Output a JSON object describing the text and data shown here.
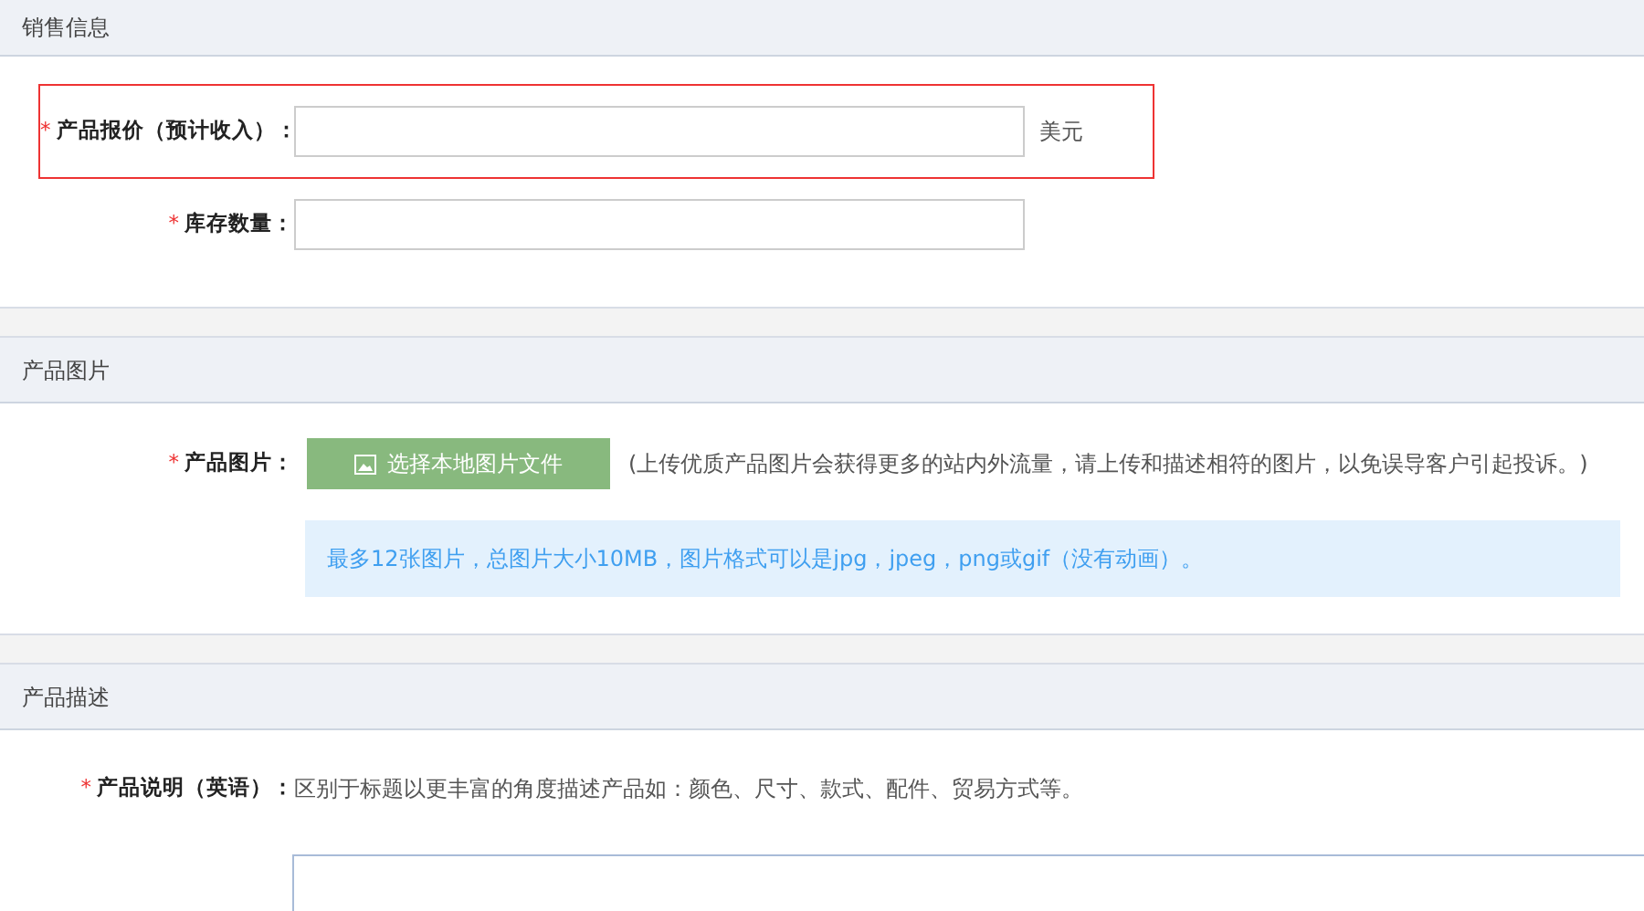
{
  "required_mark": "*",
  "sections": [
    {
      "title": "销售信息",
      "rows": [
        {
          "kind": "input",
          "label": "产品报价（预计收入）：",
          "required": true,
          "invalid": true,
          "unit": "美元"
        },
        {
          "kind": "input",
          "label": "库存数量：",
          "required": true,
          "invalid": false
        }
      ]
    },
    {
      "title": "产品图片",
      "rows": [
        {
          "kind": "upload",
          "label": "产品图片：",
          "required": true,
          "button": "选择本地图片文件",
          "hint": "(上传优质产品图片会获得更多的站内外流量，请上传和描述相符的图片，以免误导客户引起投诉。)",
          "info": "最多12张图片，总图片大小10MB，图片格式可以是jpg，jpeg，png或gif（没有动画）。"
        }
      ]
    },
    {
      "title": "产品描述",
      "rows": [
        {
          "kind": "textarea",
          "label": "产品说明（英语）：",
          "required": true,
          "hint": "区别于标题以更丰富的角度描述产品如：颜色、尺寸、款式、配件、贸易方式等。"
        }
      ]
    }
  ]
}
